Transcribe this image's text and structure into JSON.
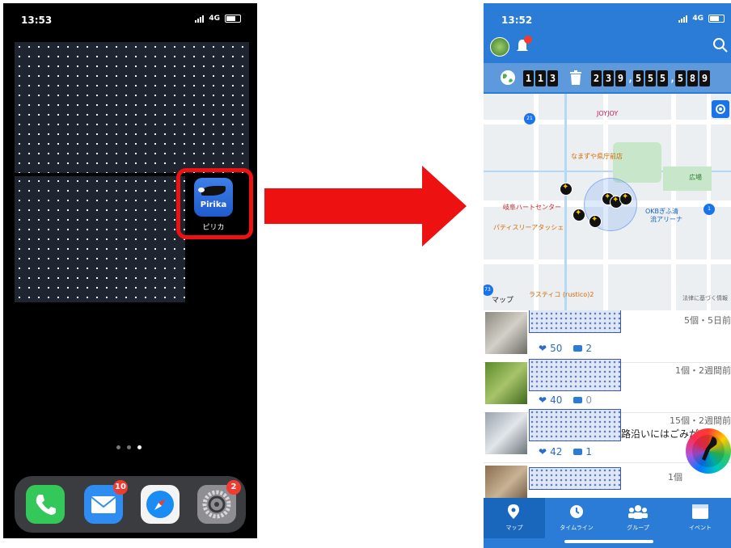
{
  "left_phone": {
    "status_time": "13:53",
    "network": "4G",
    "app": {
      "icon_text": "Pirika",
      "label": "ピリカ"
    },
    "page_dots": 3,
    "dock": {
      "mail_badge": "10",
      "settings_badge": "2"
    }
  },
  "right_phone": {
    "status_time": "13:52",
    "network": "4G",
    "counters": {
      "participants_digits": [
        "1",
        "1",
        "3"
      ],
      "trash_digits": [
        "2",
        "3",
        "9",
        ",",
        "5",
        "5",
        "5",
        ",",
        "5",
        "8",
        "9"
      ]
    },
    "map": {
      "labels": {
        "joyjoy": "JOYJOY",
        "namazuya": "なまずや県庁前店",
        "plaza": "広場",
        "gifu_heart": "岐阜ハートセンター",
        "patisserie": "パティスリーアタッシェ",
        "okb_arena_1": "OKBぎふ清",
        "okb_arena_2": "流アリーナ",
        "rustico": "ラスティコ (rustico)2",
        "map_tab": "マップ",
        "legal": "法律に基づく情報",
        "road_21": "21",
        "road_73": "73",
        "road_1": "1"
      }
    },
    "feed": [
      {
        "meta": "5個・5日前",
        "likes": "50",
        "comments": "2"
      },
      {
        "meta": "1個・2週間前",
        "likes": "40",
        "comments": "0"
      },
      {
        "meta": "15個・2週間前",
        "text": "路沿いにはごみが",
        "likes": "42",
        "comments": "1"
      },
      {
        "meta": "1個"
      }
    ],
    "tabs": [
      {
        "label": "マップ",
        "icon": "map-pin-icon"
      },
      {
        "label": "タイムライン",
        "icon": "clock-icon"
      },
      {
        "label": "グループ",
        "icon": "group-icon"
      },
      {
        "label": "イベント",
        "icon": "calendar-icon"
      }
    ]
  },
  "colors": {
    "app_blue": "#2a7cd6",
    "highlight_red": "#e11111"
  }
}
